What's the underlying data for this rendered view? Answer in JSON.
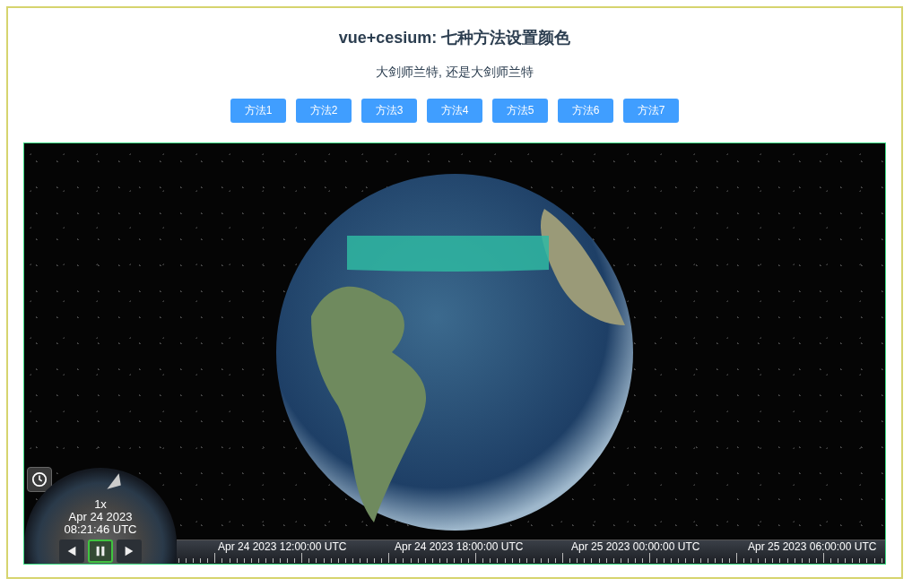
{
  "title": "vue+cesium: 七种方法设置颜色",
  "subtitle": "大剑师兰特, 还是大剑师兰特",
  "buttons": [
    "方法1",
    "方法2",
    "方法3",
    "方法4",
    "方法5",
    "方法6",
    "方法7"
  ],
  "animation": {
    "speed": "1x",
    "date": "Apr 24 2023",
    "time": "08:21:46 UTC",
    "controls": [
      {
        "kind": "reverse",
        "selected": false
      },
      {
        "kind": "pause",
        "selected": true
      },
      {
        "kind": "play",
        "selected": false
      }
    ]
  },
  "timeline": {
    "labels": [
      "Apr 24 2023 12:00:00 UTC",
      "Apr 24 2023 18:00:00 UTC",
      "Apr 25 2023 00:00:00 UTC",
      "Apr 25 2023 06:00:00 UTC"
    ]
  }
}
